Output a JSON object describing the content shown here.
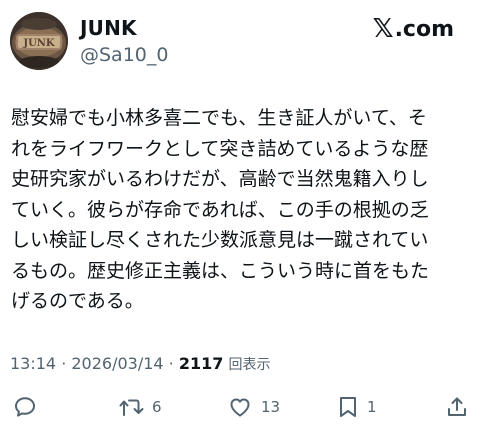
{
  "post": {
    "author": {
      "display_name": "JUNK",
      "handle": "@Sa10_0",
      "avatar_text": "JUNK"
    },
    "brand": {
      "logo_letter": "𝕏",
      "logo_suffix": ".com"
    },
    "text_lines": [
      "慰安婦でも小林多喜二でも、生き証人がいて、そ",
      "れをライフワークとして突き詰めているような歴",
      "史研究家がいるわけだが、高齢で当然鬼籍入りし",
      "ていく。彼らが存命であれば、この手の根拠の乏",
      "しい検証し尽くされた少数派意見は一蹴されてい",
      "るもの。歴史修正主義は、こういう時に首をもた",
      "げるのである。"
    ],
    "meta": {
      "time": "13:14",
      "separator": " · ",
      "date": "2026/03/14",
      "views_count": "2117",
      "views_label": "回表示"
    },
    "actions": {
      "reply_count": "",
      "repost_count": "6",
      "like_count": "13",
      "bookmark_count": "1"
    }
  },
  "colors": {
    "text": "#0f1419",
    "secondary": "#536471",
    "background": "#ffffff"
  }
}
